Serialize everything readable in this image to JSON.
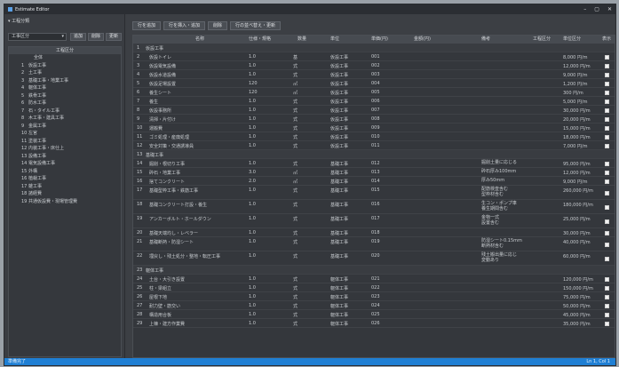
{
  "window": {
    "title": "Estimate Editor",
    "controls": [
      "–",
      "▢",
      "✕"
    ]
  },
  "sidebar": {
    "caption": "▾ 工程分類",
    "select_value": "工事区分",
    "buttons": [
      "追加",
      "削除",
      "更新"
    ],
    "tree_header": "工程区分",
    "items": [
      {
        "num": "",
        "label": "全体",
        "root": true
      },
      {
        "num": "1",
        "label": "仮設工事"
      },
      {
        "num": "2",
        "label": "土工事"
      },
      {
        "num": "3",
        "label": "基礎工事・地業工事"
      },
      {
        "num": "4",
        "label": "躯体工事"
      },
      {
        "num": "5",
        "label": "鉄骨工事"
      },
      {
        "num": "6",
        "label": "防水工事"
      },
      {
        "num": "7",
        "label": "石・タイル工事"
      },
      {
        "num": "8",
        "label": "木工事・建具工事"
      },
      {
        "num": "9",
        "label": "金属工事"
      },
      {
        "num": "10",
        "label": "左官"
      },
      {
        "num": "11",
        "label": "塗装工事"
      },
      {
        "num": "12",
        "label": "内装工事・床仕上"
      },
      {
        "num": "13",
        "label": "設備工事"
      },
      {
        "num": "14",
        "label": "電気設備工事"
      },
      {
        "num": "15",
        "label": "外構"
      },
      {
        "num": "16",
        "label": "植栽工事"
      },
      {
        "num": "17",
        "label": "雑工事"
      },
      {
        "num": "18",
        "label": "諸経費"
      },
      {
        "num": "19",
        "label": "共通仮設費・現場管理費"
      }
    ]
  },
  "toolbar": {
    "buttons": [
      "行を追加",
      "行を挿入・追加",
      "削除",
      "行の並べ替え・更新"
    ]
  },
  "grid": {
    "columns": [
      "",
      "名称",
      "仕様・規格",
      "数量",
      "単位",
      "単価(円)",
      "金額(円)",
      "備考",
      "工程区分",
      "単位区分",
      "表示"
    ],
    "rows": [
      {
        "group": true,
        "no": "1",
        "name": "仮設工事"
      },
      {
        "no": "2",
        "name": "仮設トイレ",
        "qty": "1.0",
        "unit": "基",
        "price": "8,000",
        "amount": "8,000",
        "cat": "仮設工事",
        "code": "001",
        "tax": "8,000 円/m",
        "check": true
      },
      {
        "no": "3",
        "name": "仮設電気設備",
        "qty": "1.0",
        "unit": "式",
        "price": "12,000",
        "amount": "12,000",
        "cat": "仮設工事",
        "code": "002",
        "tax": "12,000 円/m",
        "check": true
      },
      {
        "no": "4",
        "name": "仮設水道設備",
        "qty": "1.0",
        "unit": "式",
        "price": "9,000",
        "amount": "9,000",
        "cat": "仮設工事",
        "code": "003",
        "tax": "9,000 円/m",
        "check": true
      },
      {
        "no": "5",
        "name": "仮設足場設置",
        "qty": "120",
        "unit": "㎡",
        "price": "1,200",
        "amount": "144,000",
        "cat": "仮設工事",
        "code": "004",
        "tax": "1,200 円/m",
        "check": true
      },
      {
        "no": "6",
        "name": "養生シート",
        "qty": "120",
        "unit": "㎡",
        "price": "300",
        "amount": "36,000",
        "cat": "仮設工事",
        "code": "005",
        "tax": "300 円/m",
        "check": true
      },
      {
        "no": "7",
        "name": "養生",
        "qty": "1.0",
        "unit": "式",
        "price": "5,000",
        "amount": "5,000",
        "cat": "仮設工事",
        "code": "006",
        "tax": "5,000 円/m",
        "check": true
      },
      {
        "no": "8",
        "name": "仮設事務所",
        "qty": "1.0",
        "unit": "式",
        "price": "30,000",
        "amount": "30,000",
        "cat": "仮設工事",
        "code": "007",
        "tax": "30,000 円/m",
        "check": true
      },
      {
        "no": "9",
        "name": "清掃・片付け",
        "qty": "1.0",
        "unit": "式",
        "price": "20,000",
        "amount": "20,000",
        "cat": "仮設工事",
        "code": "008",
        "tax": "20,000 円/m",
        "check": true
      },
      {
        "no": "10",
        "name": "運搬費",
        "qty": "1.0",
        "unit": "式",
        "price": "15,000",
        "amount": "15,000",
        "cat": "仮設工事",
        "code": "009",
        "tax": "15,000 円/m",
        "check": true
      },
      {
        "no": "11",
        "name": "ゴミ処理・産廃処理",
        "qty": "1.0",
        "unit": "式",
        "price": "18,000",
        "amount": "18,000",
        "cat": "仮設工事",
        "code": "010",
        "tax": "18,000 円/m",
        "check": true
      },
      {
        "no": "12",
        "name": "安全対策・交通誘導員",
        "qty": "1.0",
        "unit": "式",
        "price": "7,000",
        "amount": "7,000",
        "cat": "仮設工事",
        "code": "011",
        "tax": "7,000 円/m",
        "check": true
      },
      {
        "group": true,
        "no": "13",
        "name": "基礎工事"
      },
      {
        "no": "14",
        "name": "掘削・根切り工事",
        "qty": "1.0",
        "unit": "式",
        "price": "95,000",
        "amount": "95,000",
        "cat": "基礎工事",
        "code": "012",
        "note": "掘削土量に応じる",
        "tax": "95,000 円/m",
        "check": true
      },
      {
        "no": "15",
        "name": "砕石・地業工事",
        "qty": "3.0",
        "unit": "㎡",
        "price": "12,000",
        "amount": "36,000",
        "cat": "基礎工事",
        "code": "013",
        "note": "砕石厚み100mm",
        "tax": "12,000 円/m",
        "check": true
      },
      {
        "no": "16",
        "name": "捨てコンクリート",
        "qty": "2.0",
        "unit": "㎡",
        "price": "9,000",
        "amount": "18,000",
        "cat": "基礎工事",
        "code": "014",
        "note": "厚み50mm",
        "tax": "9,000 円/m",
        "check": true
      },
      {
        "no": "17",
        "name": "基礎型枠工事・鉄筋工事",
        "qty": "1.0",
        "unit": "式",
        "price": "260,000",
        "amount": "260,000",
        "cat": "基礎工事",
        "code": "015",
        "note": "配筋検査含む\n型枠材含む",
        "tax": "260,000 円/m",
        "check": true,
        "tall": true
      },
      {
        "no": "18",
        "name": "基礎コンクリート打設・養生",
        "qty": "1.0",
        "unit": "式",
        "price": "180,000",
        "amount": "180,000",
        "cat": "基礎工事",
        "code": "016",
        "note": "生コン・ポンプ車\n養生期間含む",
        "tax": "180,000 円/m",
        "check": true,
        "tall": true
      },
      {
        "no": "19",
        "name": "アンカーボルト・ホールダウン",
        "qty": "1.0",
        "unit": "式",
        "price": "25,000",
        "amount": "25,000",
        "cat": "基礎工事",
        "code": "017",
        "note": "金物一式\n設置含む",
        "tax": "25,000 円/m",
        "check": true,
        "tall": true
      },
      {
        "no": "20",
        "name": "基礎天端均し・レベラー",
        "qty": "1.0",
        "unit": "式",
        "price": "30,000",
        "amount": "30,000",
        "cat": "基礎工事",
        "code": "018",
        "tax": "30,000 円/m",
        "check": true
      },
      {
        "no": "21",
        "name": "基礎断熱・防湿シート",
        "qty": "1.0",
        "unit": "式",
        "price": "40,000",
        "amount": "40,000",
        "cat": "基礎工事",
        "code": "019",
        "note": "防湿シート0.15mm\n断熱材含む",
        "tax": "40,000 円/m",
        "check": true,
        "tall": true
      },
      {
        "no": "22",
        "name": "埋戻し・残土処分・整地・転圧工事",
        "qty": "1.0",
        "unit": "式",
        "price": "60,000",
        "amount": "60,000",
        "cat": "基礎工事",
        "code": "020",
        "note": "残土搬出量に応じ\n変動あり",
        "tax": "60,000 円/m",
        "check": true,
        "tall": true
      },
      {
        "group": true,
        "no": "23",
        "name": "躯体工事"
      },
      {
        "no": "24",
        "name": "土台・大引き設置",
        "qty": "1.0",
        "unit": "式",
        "price": "120,000",
        "amount": "120,000",
        "cat": "躯体工事",
        "code": "021",
        "tax": "120,000 円/m",
        "check": true
      },
      {
        "no": "25",
        "name": "柱・梁組立",
        "qty": "1.0",
        "unit": "式",
        "price": "150,000",
        "amount": "150,000",
        "cat": "躯体工事",
        "code": "022",
        "tax": "150,000 円/m",
        "check": true
      },
      {
        "no": "26",
        "name": "屋根下地",
        "qty": "1.0",
        "unit": "式",
        "price": "75,000",
        "amount": "75,000",
        "cat": "躯体工事",
        "code": "023",
        "tax": "75,000 円/m",
        "check": true
      },
      {
        "no": "27",
        "name": "耐力壁・筋交い",
        "qty": "1.0",
        "unit": "式",
        "price": "50,000",
        "amount": "50,000",
        "cat": "躯体工事",
        "code": "024",
        "tax": "50,000 円/m",
        "check": true
      },
      {
        "no": "28",
        "name": "構造用合板",
        "qty": "1.0",
        "unit": "式",
        "price": "45,000",
        "amount": "45,000",
        "cat": "躯体工事",
        "code": "025",
        "tax": "45,000 円/m",
        "check": true
      },
      {
        "no": "29",
        "name": "上棟・建方作業費",
        "qty": "1.0",
        "unit": "式",
        "price": "35,000",
        "amount": "35,000",
        "cat": "躯体工事",
        "code": "026",
        "tax": "35,000 円/m",
        "check": true
      }
    ]
  },
  "status": {
    "left": "準備完了",
    "right": "Ln 1, Col 1"
  }
}
